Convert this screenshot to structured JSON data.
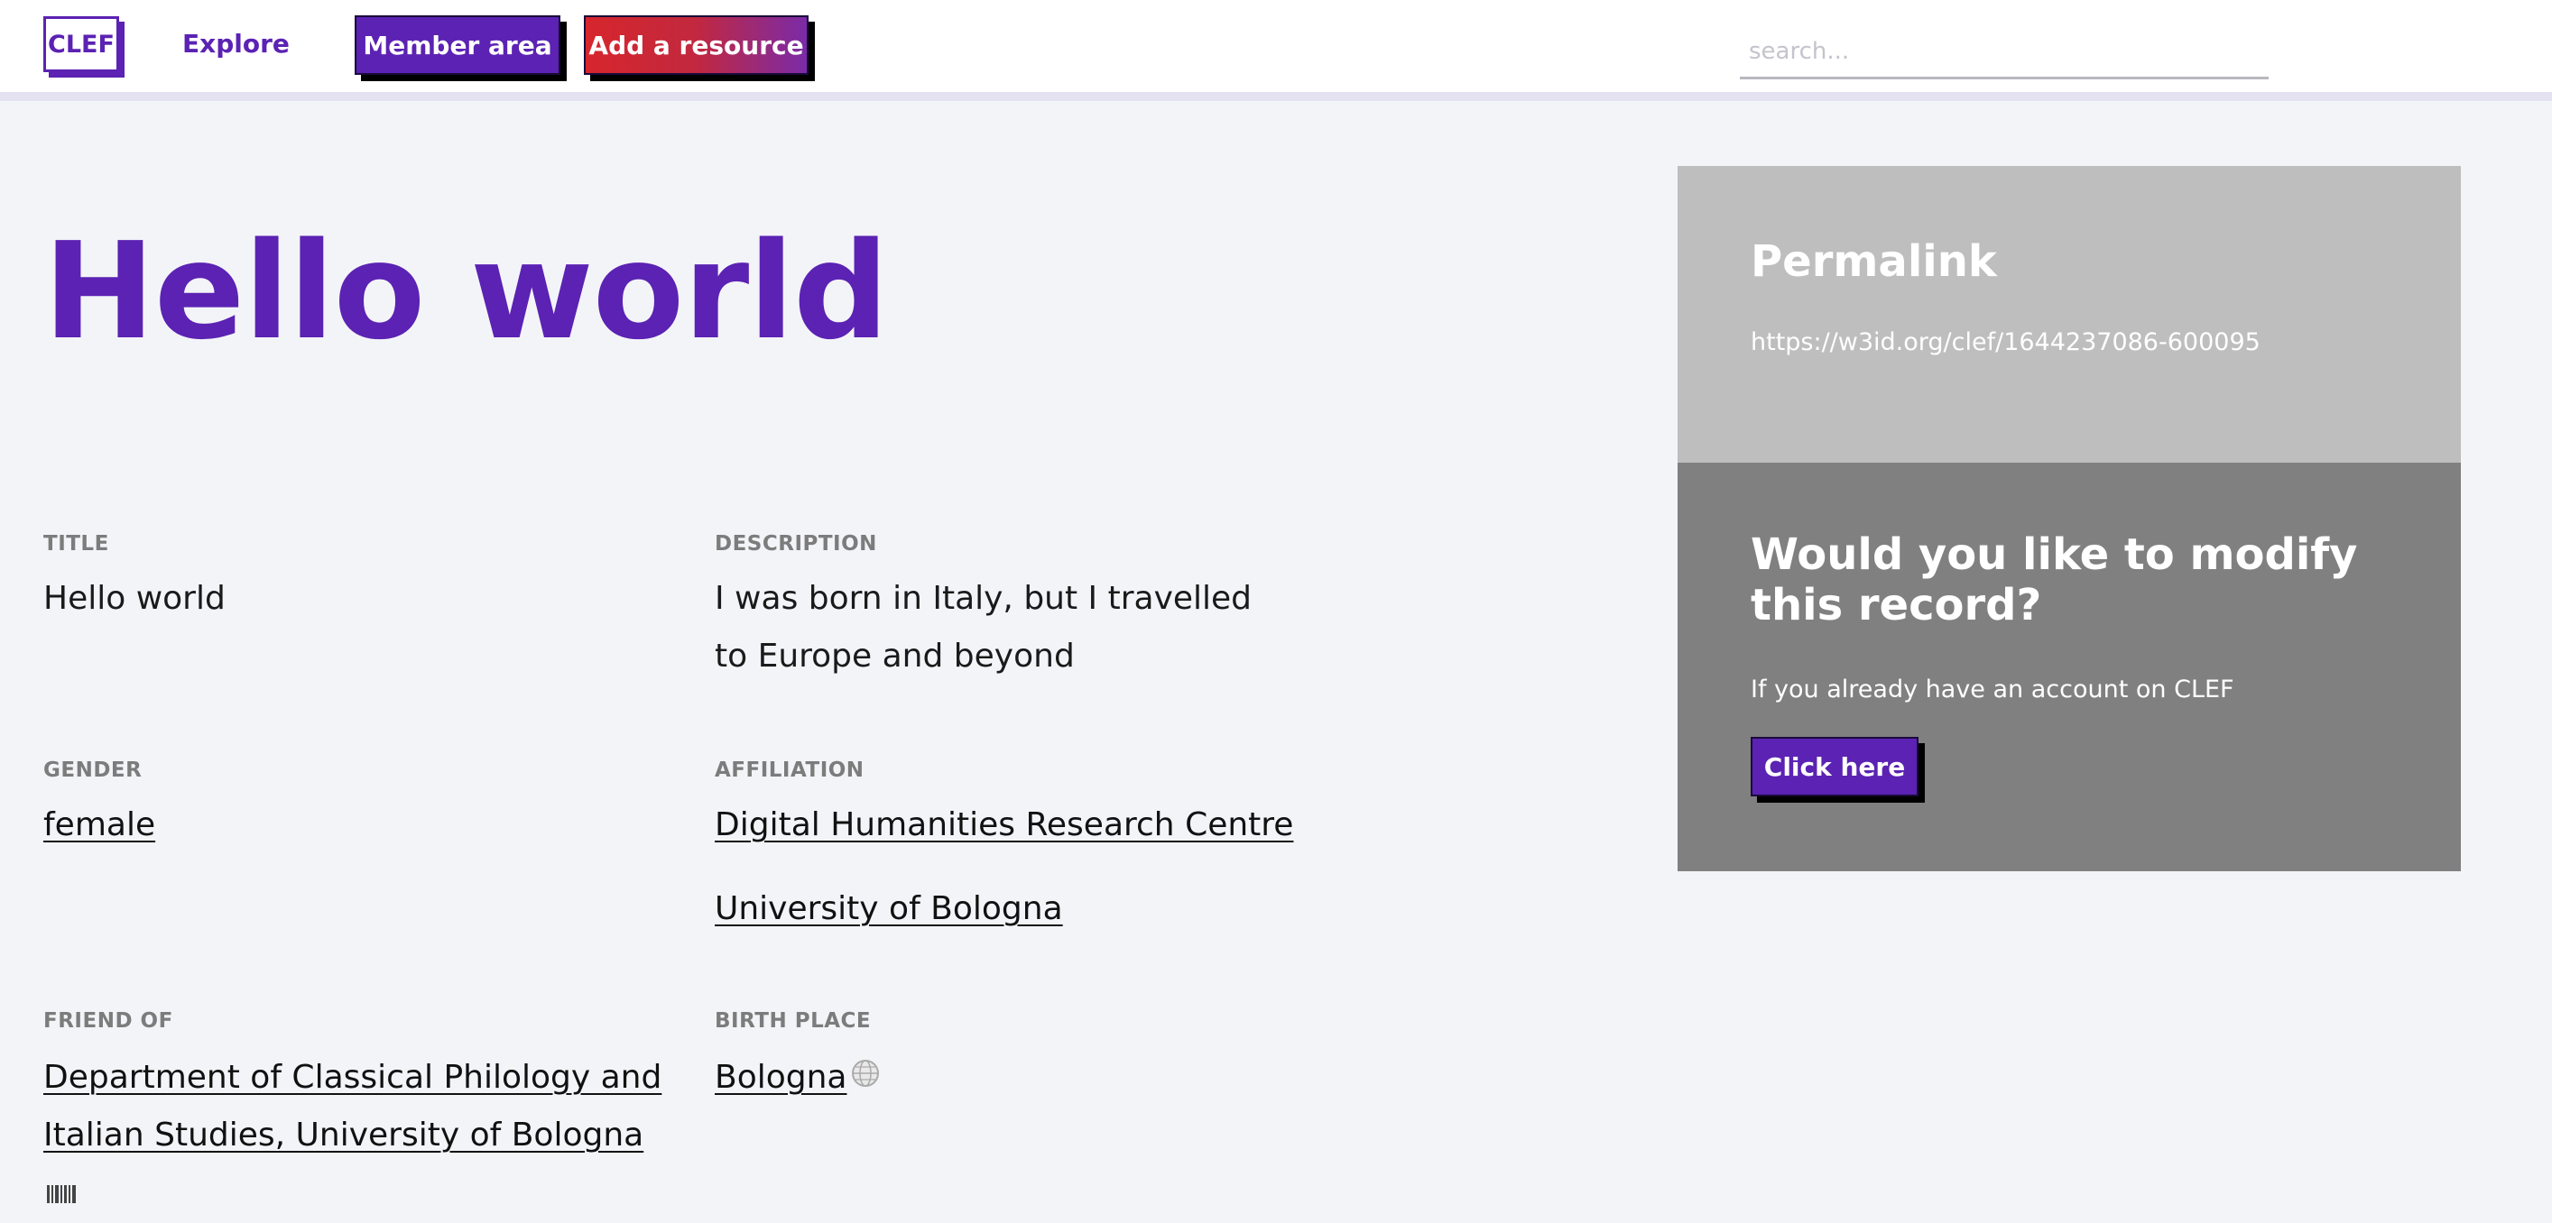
{
  "header": {
    "logo_label": "CLEF",
    "nav_explore": "Explore",
    "member_button": "Member area",
    "add_resource_button": "Add a resource",
    "search_placeholder": "search..."
  },
  "record": {
    "page_title": "Hello world",
    "fields": {
      "title": {
        "label": "TITLE",
        "value": "Hello world"
      },
      "description": {
        "label": "DESCRIPTION",
        "value": "I was born in Italy, but I travelled to Europe and beyond"
      },
      "gender": {
        "label": "GENDER",
        "value": "female"
      },
      "affiliation": {
        "label": "AFFILIATION",
        "values": [
          "Digital Humanities Research Centre",
          "University of Bologna"
        ]
      },
      "friend_of": {
        "label": "FRIEND OF",
        "value": "Department of Classical Philology and Italian Studies, University of Bologna"
      },
      "birth_place": {
        "label": "BIRTH PLACE",
        "value": "Bologna"
      }
    }
  },
  "sidebar": {
    "permalink_title": "Permalink",
    "permalink_url": "https://w3id.org/clef/1644237086-600095",
    "modify_title": "Would you like to modify this record?",
    "modify_text": "If you already have an account on CLEF",
    "click_button": "Click here"
  },
  "colors": {
    "brand": "#5b22b3",
    "add_button_start": "#d6262c",
    "add_button_end": "#7a2ba8",
    "permalink_bg": "#bebebe",
    "modify_bg": "#808080"
  },
  "icons": {
    "friend_of_icon": "barcode-icon",
    "birth_place_icon": "globe-icon"
  }
}
